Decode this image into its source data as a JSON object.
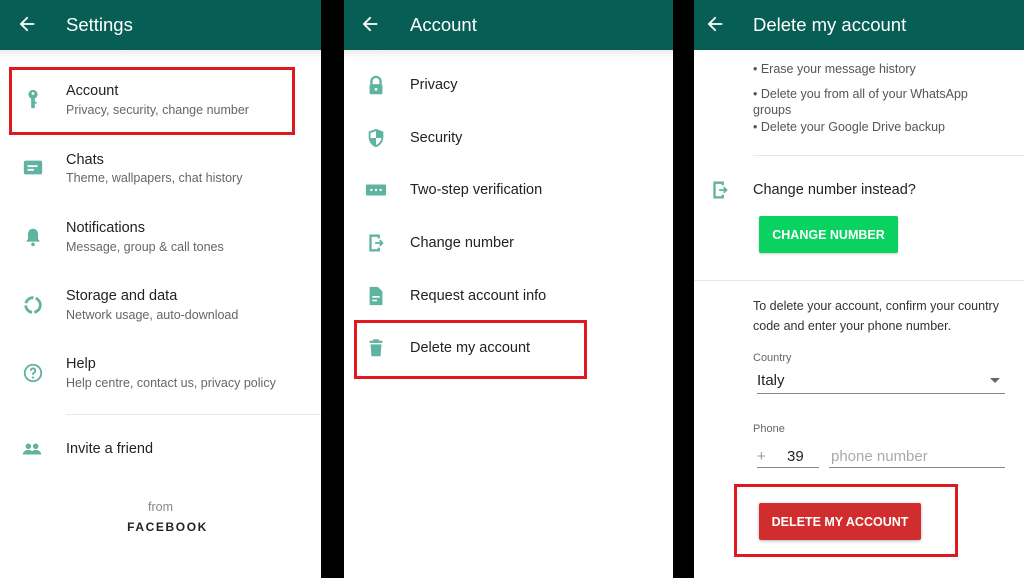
{
  "colors": {
    "appbar": "#075e54",
    "icon_teal": "#5fb3a1",
    "highlight_red": "#e0191f",
    "green_button": "#09d261",
    "red_button": "#d12d2f"
  },
  "settings_screen": {
    "title": "Settings",
    "back_icon": "arrow-left-icon",
    "items": [
      {
        "icon": "key-icon",
        "title": "Account",
        "subtitle": "Privacy, security, change number",
        "highlighted": true
      },
      {
        "icon": "chat-icon",
        "title": "Chats",
        "subtitle": "Theme, wallpapers, chat history"
      },
      {
        "icon": "bell-icon",
        "title": "Notifications",
        "subtitle": "Message, group & call tones"
      },
      {
        "icon": "data-usage-icon",
        "title": "Storage and data",
        "subtitle": "Network usage, auto-download"
      },
      {
        "icon": "help-icon",
        "title": "Help",
        "subtitle": "Help centre, contact us, privacy policy"
      },
      {
        "icon": "people-icon",
        "title": "Invite a friend"
      }
    ],
    "footer_from": "from",
    "footer_brand": "FACEBOOK"
  },
  "account_screen": {
    "title": "Account",
    "back_icon": "arrow-left-icon",
    "items": [
      {
        "icon": "lock-icon",
        "title": "Privacy"
      },
      {
        "icon": "shield-icon",
        "title": "Security"
      },
      {
        "icon": "password-dots-icon",
        "title": "Two-step verification"
      },
      {
        "icon": "change-number-icon",
        "title": "Change number"
      },
      {
        "icon": "document-icon",
        "title": "Request account info"
      },
      {
        "icon": "trash-icon",
        "title": "Delete my account",
        "highlighted": true
      }
    ]
  },
  "delete_screen": {
    "title": "Delete my account",
    "back_icon": "arrow-left-icon",
    "bullets": [
      "• Erase your message history",
      "• Delete you from all of your WhatsApp groups",
      "• Delete your Google Drive backup"
    ],
    "change_number_prompt": "Change number instead?",
    "change_number_button": "CHANGE NUMBER",
    "instructions": "To delete your account, confirm your country code and enter your phone number.",
    "country_label": "Country",
    "country_value": "Italy",
    "phone_label": "Phone",
    "country_code_prefix": "+",
    "country_code": "39",
    "phone_placeholder": "phone number",
    "delete_button": "DELETE MY ACCOUNT"
  }
}
